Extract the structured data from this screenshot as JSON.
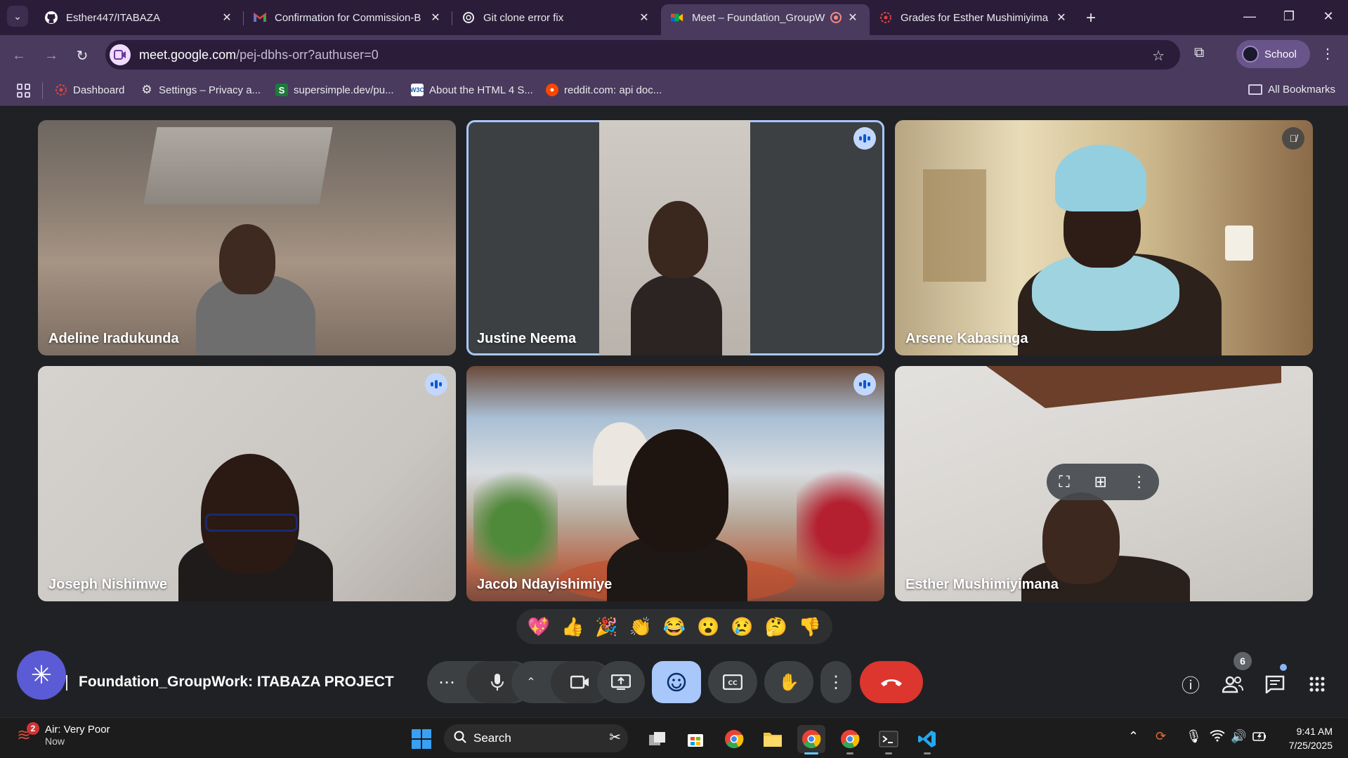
{
  "browser": {
    "tabs": [
      {
        "title": "Esther447/ITABAZA",
        "favicon": "github-icon",
        "active": false
      },
      {
        "title": "Confirmation for Commission-B",
        "favicon": "gmail-icon",
        "active": false
      },
      {
        "title": "Git clone error fix",
        "favicon": "chatgpt-icon",
        "active": false
      },
      {
        "title": "Meet – Foundation_GroupW",
        "favicon": "meet-icon",
        "active": true
      },
      {
        "title": "Grades for Esther Mushimiyima",
        "favicon": "canvas-icon",
        "active": false
      }
    ],
    "url_host": "meet.google.com",
    "url_path": "/pej-dbhs-orr?authuser=0",
    "profile_label": "School",
    "bookmarks": [
      {
        "label": "Dashboard",
        "icon": "canvas-icon"
      },
      {
        "label": "Settings – Privacy a...",
        "icon": "gear-icon"
      },
      {
        "label": "supersimple.dev/pu...",
        "icon": "supersimple-icon"
      },
      {
        "label": "About the HTML 4 S...",
        "icon": "w3c-icon"
      },
      {
        "label": "reddit.com: api doc...",
        "icon": "reddit-icon"
      }
    ],
    "all_bookmarks_label": "All Bookmarks"
  },
  "meet": {
    "participants": [
      {
        "name": "Adeline Iradukunda",
        "status": "none"
      },
      {
        "name": "Justine Neema",
        "status": "speaking"
      },
      {
        "name": "Arsene Kabasinga",
        "status": "muted"
      },
      {
        "name": "Joseph Nishimwe",
        "status": "speaking"
      },
      {
        "name": "Jacob Ndayishimiye",
        "status": "speaking"
      },
      {
        "name": "Esther Mushimiyimana",
        "status": "none"
      }
    ],
    "reactions": [
      "💖",
      "👍",
      "🎉",
      "👏",
      "😂",
      "😮",
      "😢",
      "🤔",
      "👎"
    ],
    "meeting_title": "Foundation_GroupWork: ITABAZA PROJECT",
    "participant_count": "6"
  },
  "taskbar": {
    "weather_label": "Air: Very Poor",
    "weather_sub": "Now",
    "weather_badge": "2",
    "search_label": "Search",
    "time": "9:41 AM",
    "date": "7/25/2025"
  }
}
